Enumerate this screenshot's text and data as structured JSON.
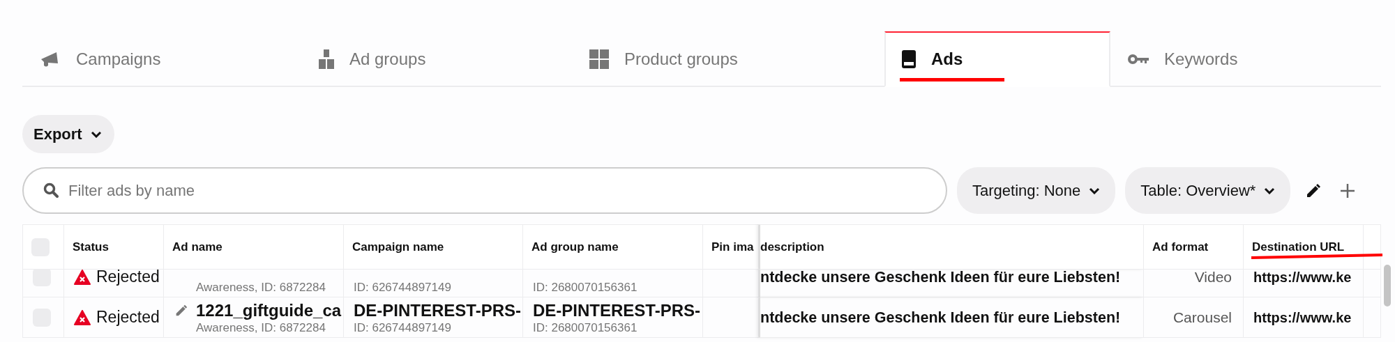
{
  "tabs": [
    {
      "label": "Campaigns",
      "selected": false
    },
    {
      "label": "Ad groups",
      "selected": false
    },
    {
      "label": "Product groups",
      "selected": false
    },
    {
      "label": "Ads",
      "selected": true
    },
    {
      "label": "Keywords",
      "selected": false
    }
  ],
  "export_button": {
    "label": "Export"
  },
  "search": {
    "placeholder": "Filter ads by name"
  },
  "filters": [
    {
      "label": "Targeting: None"
    },
    {
      "label": "Table: Overview*"
    }
  ],
  "table": {
    "columns": [
      "Status",
      "Ad name",
      "Campaign name",
      "Ad group name",
      "Pin ima",
      "description",
      "Ad format",
      "Destination URL"
    ],
    "header_checked": false,
    "rows": [
      {
        "checked": false,
        "status": "Rejected",
        "ad_name_sub": "Awareness, ID: 6872284",
        "campaign_id": "ID: 626744897149",
        "ad_group_id": "ID: 2680070156361",
        "description": "ntdecke unsere Geschenk Ideen für eure Liebsten!",
        "ad_format": "Video",
        "destination_url": "https://www.ke"
      },
      {
        "checked": false,
        "status": "Rejected",
        "ad_name": "1221_giftguide_ca",
        "ad_name_sub": "Awareness, ID: 6872284",
        "campaign_name": "DE-PINTEREST-PRS-",
        "campaign_id": "ID: 626744897149",
        "ad_group_name": "DE-PINTEREST-PRS-",
        "ad_group_id": "ID: 2680070156361",
        "description": "ntdecke unsere Geschenk Ideen für eure Liebsten!",
        "ad_format": "Carousel",
        "destination_url": "https://www.ke"
      }
    ]
  }
}
